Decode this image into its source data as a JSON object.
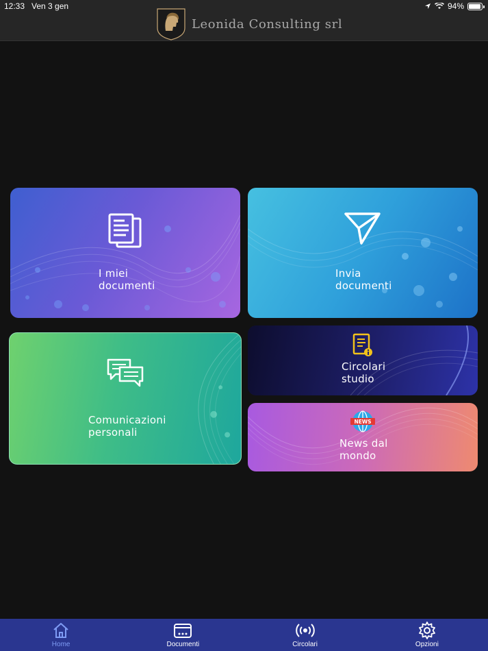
{
  "status_bar": {
    "time": "12:33",
    "date": "Ven 3 gen",
    "battery": "94%"
  },
  "header": {
    "brand": "Leonida Consulting srl",
    "logo_icon": "spartan-helmet-shield-icon"
  },
  "tiles": [
    {
      "label": "I miei\ndocumenti",
      "icon": "documents-icon"
    },
    {
      "label": "Invia\ndocumenti",
      "icon": "paper-plane-icon"
    },
    {
      "label": "Comunicazioni\npersonali",
      "icon": "chat-bubbles-icon"
    },
    {
      "label": "Circolari\nstudio",
      "icon": "document-info-icon"
    },
    {
      "label": "News dal\nmondo",
      "icon": "news-globe-icon"
    }
  ],
  "tabbar": {
    "active": "Home",
    "items": [
      {
        "label": "Home",
        "icon": "home-icon"
      },
      {
        "label": "Documenti",
        "icon": "folder-dots-icon"
      },
      {
        "label": "Circolari",
        "icon": "broadcast-icon"
      },
      {
        "label": "Opzioni",
        "icon": "gear-icon"
      }
    ]
  },
  "colors": {
    "background": "#121212",
    "header": "#262626",
    "tabbar": "#2a3690",
    "tab_active": "#7f9cf5",
    "logo_gold": "#c9a876"
  }
}
